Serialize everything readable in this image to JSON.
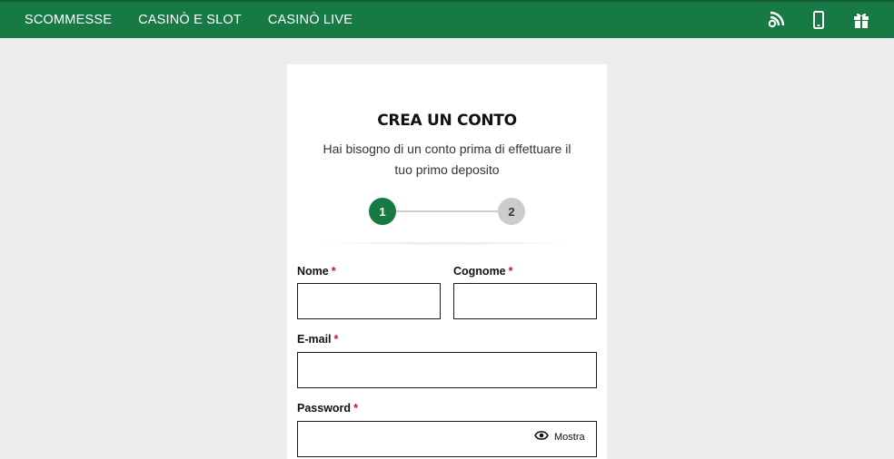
{
  "nav": {
    "items": [
      "SCOMMESSE",
      "CASINÒ E SLOT",
      "CASINÒ LIVE"
    ]
  },
  "top_icons": [
    "rss-icon",
    "mobile-phone-icon",
    "gift-icon"
  ],
  "colors": {
    "brand_green": "#177a45",
    "required_red": "#c8102e",
    "step_inactive": "#cccccc"
  },
  "card": {
    "title": "CREA UN CONTO",
    "subtitle": "Hai bisogno di un conto prima di effettuare il tuo primo deposito",
    "steps": [
      "1",
      "2"
    ],
    "active_step": "1"
  },
  "form": {
    "required_marker": "*",
    "first_name": {
      "label": "Nome",
      "value": ""
    },
    "last_name": {
      "label": "Cognome",
      "value": ""
    },
    "email": {
      "label": "E-mail",
      "value": ""
    },
    "password": {
      "label": "Password",
      "value": "",
      "show_label": "Mostra"
    }
  }
}
